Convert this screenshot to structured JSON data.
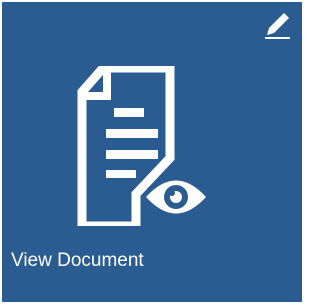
{
  "tile": {
    "label": "View Document",
    "background_color": "#2a5b91",
    "foreground_color": "#ffffff",
    "main_icon": "document-view-icon",
    "action_icon": "pencil-edit-icon"
  }
}
